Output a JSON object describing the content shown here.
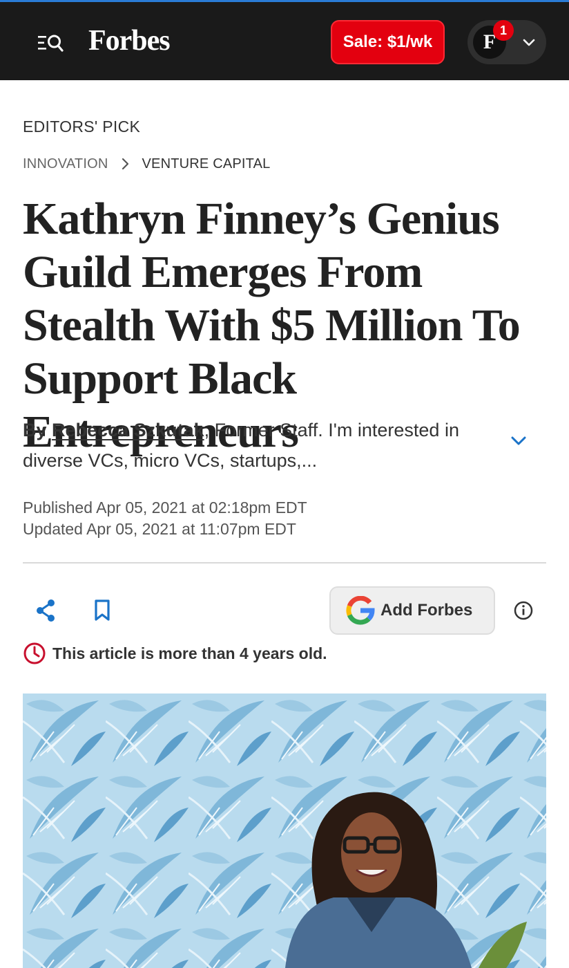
{
  "header": {
    "logo_text": "Forbes",
    "sale_label": "Sale: $1/wk",
    "avatar_initial": "F",
    "notification_count": "1",
    "colors": {
      "bar": "#1a1a1a",
      "sale": "#e3000f",
      "accent": "#1a73c8"
    }
  },
  "article": {
    "kicker": "EDITORS' PICK",
    "breadcrumb": [
      "INNOVATION",
      "VENTURE CAPITAL"
    ],
    "headline": "Kathryn Finney’s Genius Guild Emerges From Stealth With $5 Million To Support Black Entrepreneurs",
    "byline": {
      "prefix": "By",
      "author": "Rebecca Szkutak",
      "role": ", Former Staff.",
      "bio": "I'm interested in diverse VCs, micro VCs, startups,..."
    },
    "published": "Published Apr 05, 2021 at 02:18pm EDT",
    "updated": "Updated Apr 05, 2021 at 11:07pm EDT"
  },
  "actions": {
    "share_icon": "share-icon",
    "bookmark_icon": "bookmark-icon",
    "add_forbes_label": "Add Forbes",
    "info_icon": "info-icon"
  },
  "notice": {
    "age_warning": "This article is more than 4 years old."
  }
}
